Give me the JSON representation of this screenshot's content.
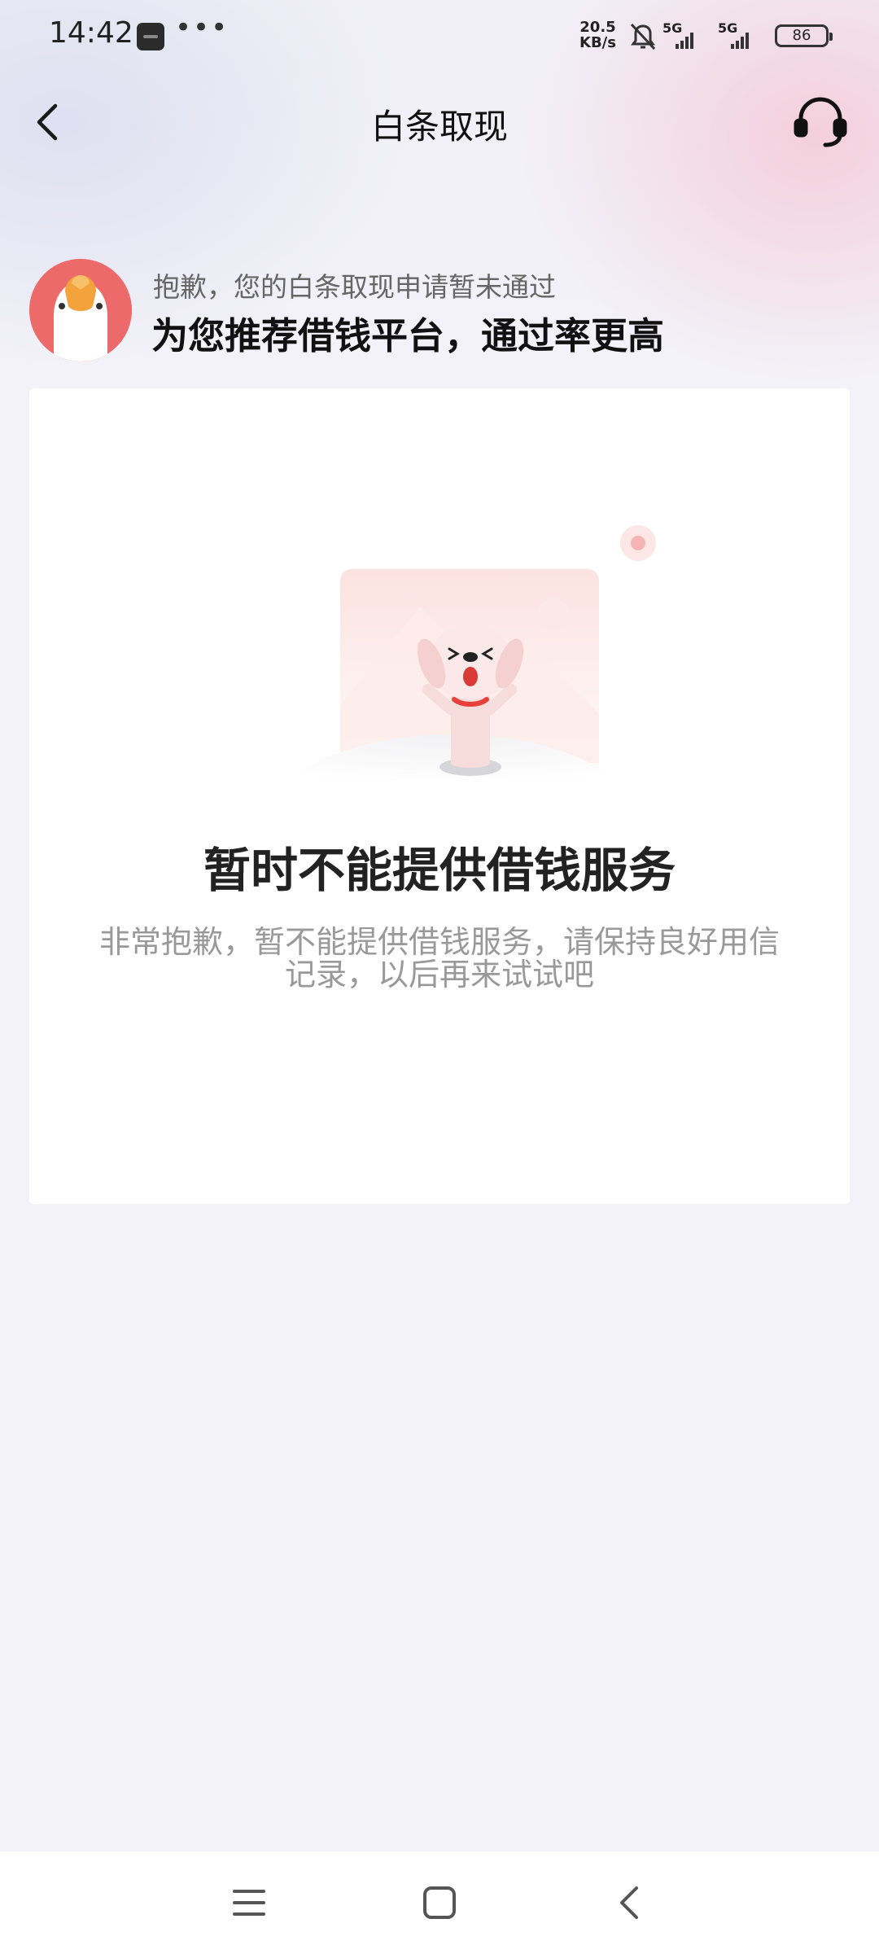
{
  "status_bar": {
    "time": "14:42",
    "more": "•••",
    "net_speed_value": "20.5",
    "net_speed_unit": "KB/s",
    "signal_1": "5G",
    "signal_2": "5G",
    "battery": "86"
  },
  "header": {
    "title": "白条取现",
    "back_icon": "chevron-left-icon",
    "support_icon": "headset-icon"
  },
  "notice": {
    "subtitle": "抱歉，您的白条取现申请暂未通过",
    "title": "为您推荐借钱平台，通过率更高"
  },
  "result": {
    "title": "暂时不能提供借钱服务",
    "description": "非常抱歉，暂不能提供借钱服务，请保持良好用信记录，以后再来试试吧"
  },
  "system_nav": {
    "menu_icon": "menu-icon",
    "home_icon": "home-square-icon",
    "back_icon": "back-triangle-icon"
  },
  "colors": {
    "background": "#f3f2f8",
    "card": "#ffffff",
    "accent_red": "#e8413c",
    "avatar_red": "#ec6a6a"
  }
}
